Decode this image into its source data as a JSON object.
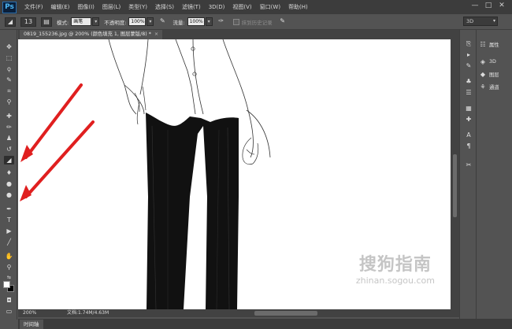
{
  "app": {
    "logo": "Ps"
  },
  "menu": [
    "文件(F)",
    "编辑(E)",
    "图像(I)",
    "图层(L)",
    "类型(Y)",
    "选择(S)",
    "滤镜(T)",
    "3D(D)",
    "视图(V)",
    "窗口(W)",
    "帮助(H)"
  ],
  "window_controls": {
    "minimize": "—",
    "restore": "□",
    "close": "✕"
  },
  "options": {
    "brush_size": "13",
    "mode_label": "模式:",
    "mode_value": "画笔",
    "opacity_label": "不透明度:",
    "opacity_value": "100%",
    "flow_label": "流量:",
    "flow_value": "100%",
    "history_label": "抹到历史记录",
    "workspace": "3D"
  },
  "document": {
    "tab_title": "0819_155236.jpg @ 200% (颜色填充 1, 图层蒙版/8) *",
    "zoom": "200%",
    "doc_info": "文档:1.74M/4.63M"
  },
  "timeline": {
    "label": "时间轴"
  },
  "right_panel": {
    "items": [
      {
        "icon": "properties-icon",
        "label": "属性"
      },
      {
        "icon": "3d-icon",
        "label": "3D"
      },
      {
        "icon": "layers-icon",
        "label": "图层"
      },
      {
        "icon": "channels-icon",
        "label": "通道"
      }
    ]
  },
  "watermark": {
    "main": "搜狗指南",
    "sub": "zhinan.sogou.com"
  },
  "colors": {
    "ui_dark": "#3c3c3c",
    "ui_mid": "#535353",
    "canvas": "#ffffff",
    "arrow": "#e01f1f"
  }
}
